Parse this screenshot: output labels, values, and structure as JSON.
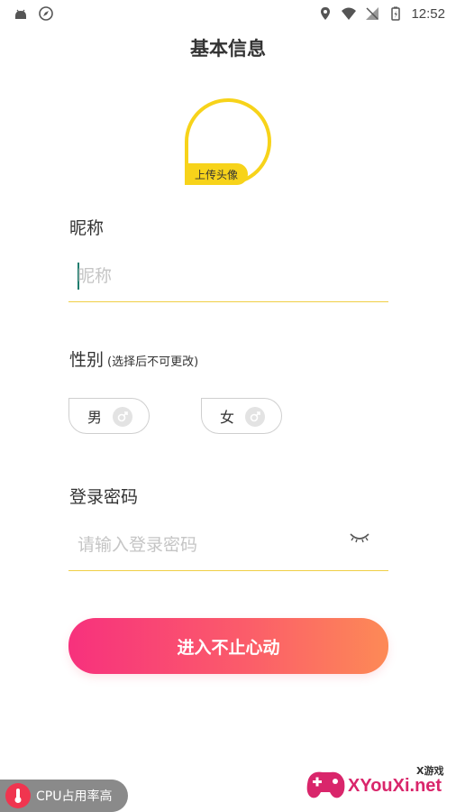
{
  "status_bar": {
    "time": "12:52",
    "icons": [
      "android-icon",
      "compass-icon",
      "location-icon",
      "wifi-icon",
      "no-signal-icon",
      "battery-icon"
    ]
  },
  "page": {
    "title": "基本信息"
  },
  "avatar": {
    "upload_label": "上传头像",
    "accent_color": "#f7d31a"
  },
  "nickname": {
    "label": "昵称",
    "placeholder": "昵称",
    "value": ""
  },
  "gender": {
    "label": "性别",
    "hint": "(选择后不可更改)",
    "options": [
      {
        "label": "男",
        "icon": "male-icon"
      },
      {
        "label": "女",
        "icon": "female-icon"
      }
    ]
  },
  "password": {
    "label": "登录密码",
    "placeholder": "请输入登录密码",
    "value": "",
    "toggle_icon": "eye-closed-icon"
  },
  "submit": {
    "label": "进入不止心动",
    "gradient": [
      "#f7317d",
      "#fd8a56"
    ]
  },
  "cpu_badge": {
    "text": "CPU占用率高"
  },
  "watermark": {
    "site": "XYouXi.net",
    "sub": "X游戏"
  }
}
